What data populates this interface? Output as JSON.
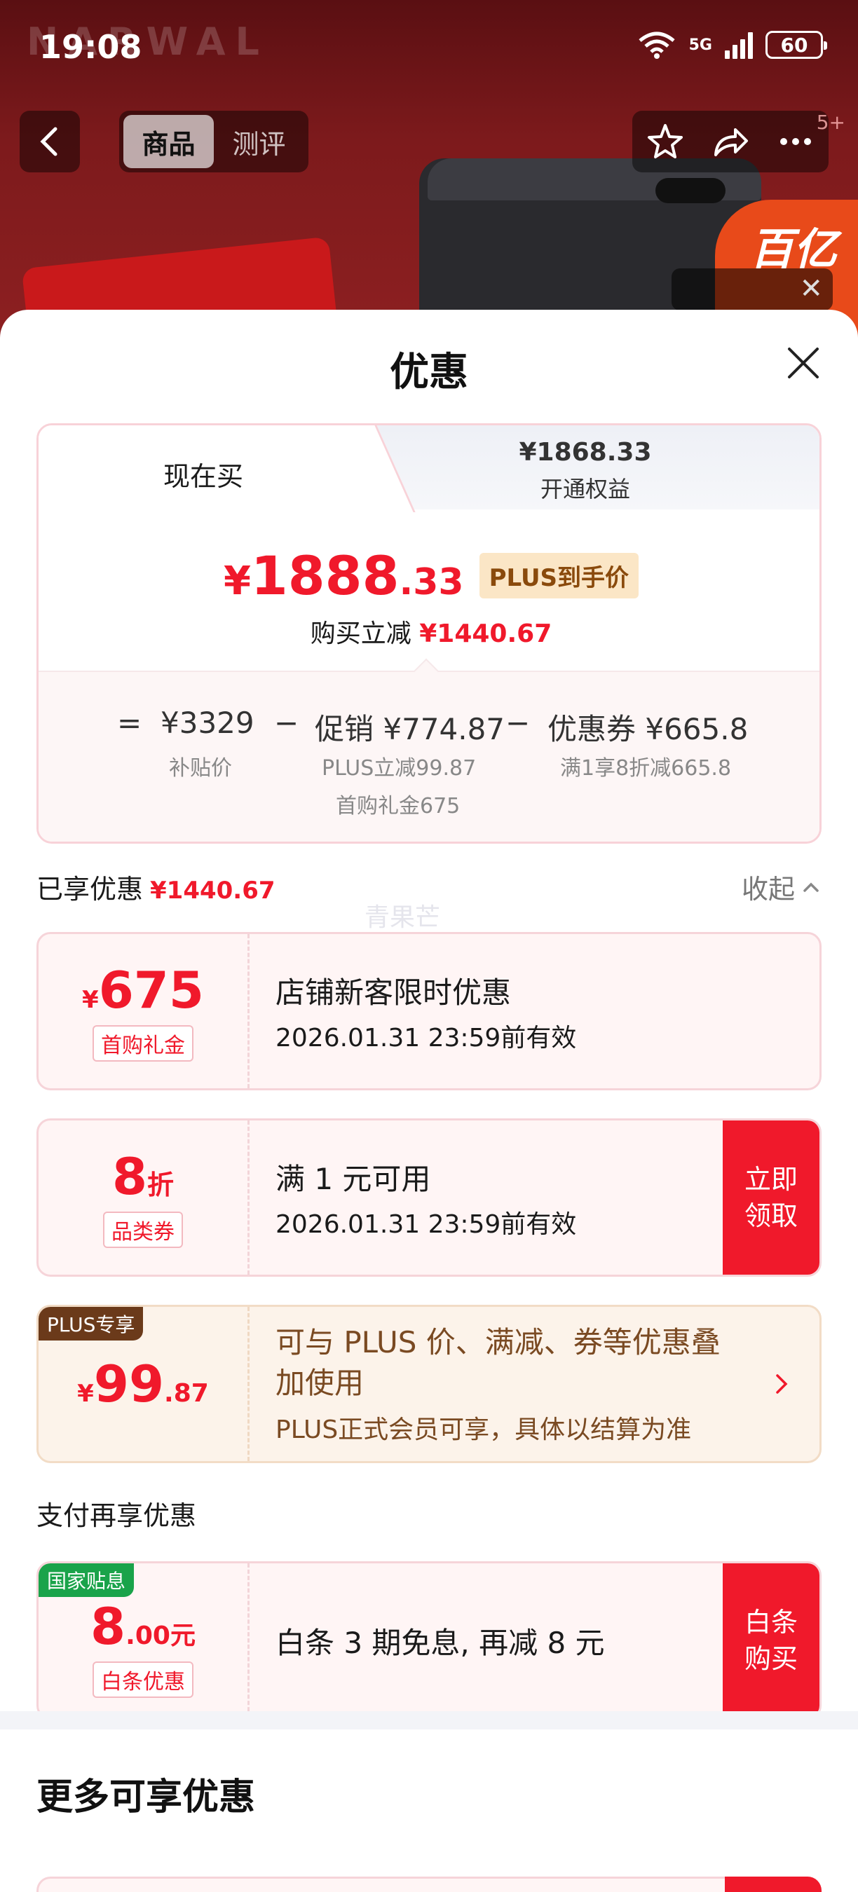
{
  "status_bar": {
    "time": "19:08",
    "network": "5G",
    "battery": "60"
  },
  "background": {
    "brand": "NARWAL",
    "tabs": [
      "商品",
      "测评"
    ],
    "badge": "5+",
    "promo": "百亿"
  },
  "sheet": {
    "title": "优惠"
  },
  "price_card": {
    "tab_now": "现在买",
    "tab_other_price": "¥1868.33",
    "tab_other_label": "开通权益",
    "price_symbol": "¥",
    "price_int": "1888",
    "price_dec": ".33",
    "price_tag": "PLUS到手价",
    "reduce_label": "购买立减",
    "reduce_value": "¥1440.67",
    "formula": {
      "eq": "=",
      "base": "¥3329",
      "base_label": "补贴价",
      "minus1": "−",
      "promo": "促销 ¥774.87",
      "promo_sub1": "PLUS立减99.87",
      "promo_sub2": "首购礼金675",
      "minus2": "−",
      "coupon": "优惠券 ¥665.8",
      "coupon_sub": "满1享8折减665.8"
    }
  },
  "enjoyed": {
    "label": "已享优惠",
    "value": "¥1440.67",
    "collapse": "收起"
  },
  "watermark": "青果芒",
  "coupons": [
    {
      "symbol": "¥",
      "num": "675",
      "tag": "首购礼金",
      "title": "店铺新客限时优惠",
      "sub": "2026.01.31 23:59前有效"
    },
    {
      "num": "8",
      "unit": "折",
      "tag": "品类券",
      "title": "满 1 元可用",
      "sub": "2026.01.31 23:59前有效",
      "button": "立即\n领取"
    },
    {
      "corner": "PLUS专享",
      "symbol": "¥",
      "num": "99",
      "dec": ".87",
      "title": "可与 PLUS 价、满减、券等优惠叠加使用",
      "sub": "PLUS正式会员可享，具体以结算为准"
    }
  ],
  "pay": {
    "label": "支付再享优惠",
    "coupon": {
      "corner": "国家贴息",
      "num": "8",
      "dec": ".00",
      "unit": "元",
      "tag": "白条优惠",
      "title": "白条 3 期免息, 再减 8 元",
      "button": "白条\n购买"
    }
  },
  "more": {
    "title": "更多可享优惠"
  },
  "colors": {
    "accent_red": "#f0192b",
    "plus_brown": "#7a4a22",
    "gov_green": "#1aa34a"
  }
}
